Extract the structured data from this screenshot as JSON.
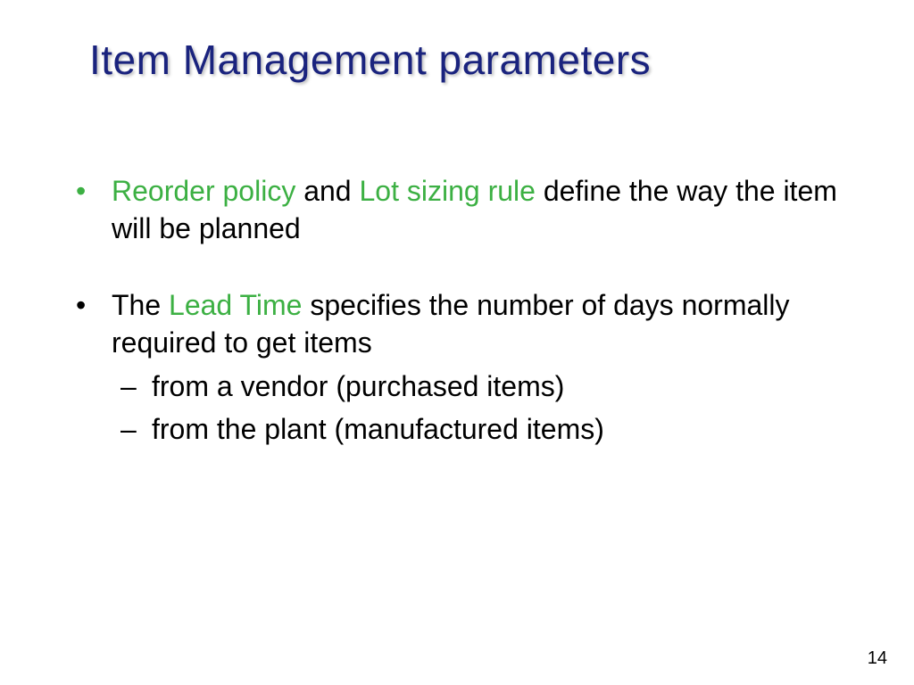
{
  "title": "Item Management parameters",
  "bullets": {
    "b1": {
      "h1": "Reorder policy",
      "t1": " and ",
      "h2": "Lot sizing rule",
      "t2": " define the way the item will be planned"
    },
    "b2": {
      "t1": "The ",
      "h1": "Lead Time",
      "t2": " specifies the number of days normally required to get items",
      "sub1": "from a vendor (purchased items)",
      "sub2": "from the plant (manufactured items)"
    }
  },
  "page_number": "14",
  "colors": {
    "title": "#1a237e",
    "highlight": "#3cb043",
    "text": "#000000"
  }
}
